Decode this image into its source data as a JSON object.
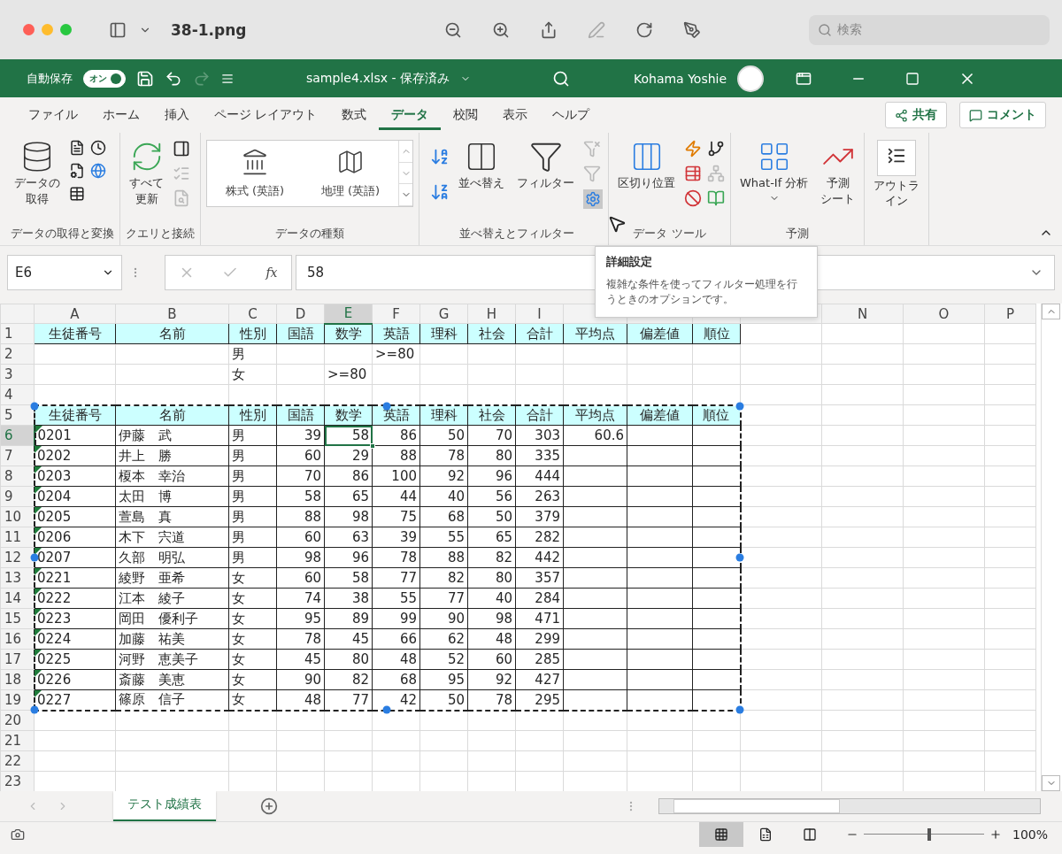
{
  "viewer": {
    "title": "38-1.png",
    "search_placeholder": "検索"
  },
  "excel_bar": {
    "autosave_label": "自動保存",
    "autosave": {
      "on": true,
      "label": "オン"
    },
    "redo_disabled": true,
    "file_title": "sample4.xlsx - 保存済み",
    "user": "Kohama Yoshie"
  },
  "ribbon_tabs": [
    {
      "label": "ファイル",
      "selected": false
    },
    {
      "label": "ホーム",
      "selected": false
    },
    {
      "label": "挿入",
      "selected": false
    },
    {
      "label": "ページ レイアウト",
      "selected": false
    },
    {
      "label": "数式",
      "selected": false
    },
    {
      "label": "データ",
      "selected": true
    },
    {
      "label": "校閲",
      "selected": false
    },
    {
      "label": "表示",
      "selected": false
    },
    {
      "label": "ヘルプ",
      "selected": false
    }
  ],
  "share_button": "共有",
  "comment_button": "コメント",
  "ribbon_groups": [
    {
      "kind": "get",
      "label": "データの取得と変換",
      "button": [
        "データの",
        "取得"
      ]
    },
    {
      "kind": "queries",
      "label": "クエリと接続",
      "button": [
        "すべて",
        "更新"
      ]
    },
    {
      "kind": "types",
      "label": "データの種類",
      "items": [
        "株式 (英語)",
        "地理 (英語)"
      ]
    },
    {
      "kind": "sort",
      "label": "並べ替えとフィルター",
      "sort": "並べ替え",
      "filter": "フィルター",
      "advanced_hovered": true
    },
    {
      "kind": "tools",
      "label": "データ ツール",
      "button": "区切り位置"
    },
    {
      "kind": "forecast",
      "label": "予測",
      "what_if": "What-If 分析",
      "sheet": [
        "予測",
        "シート"
      ]
    },
    {
      "kind": "outline",
      "button": [
        "アウトラ",
        "イン"
      ]
    }
  ],
  "formula_bar": {
    "name_box": "E6",
    "function_symbol": "fx",
    "value": "58"
  },
  "tooltip": {
    "title": "詳細設定",
    "text": "複雑な条件を使ってフィルター処理を行うときのオプションです。"
  },
  "columns": [
    {
      "label": "A",
      "selected": false
    },
    {
      "label": "B",
      "selected": false
    },
    {
      "label": "C",
      "selected": false
    },
    {
      "label": "D",
      "selected": false
    },
    {
      "label": "E",
      "selected": true
    },
    {
      "label": "F",
      "selected": false
    },
    {
      "label": "G",
      "selected": false
    },
    {
      "label": "H",
      "selected": false
    },
    {
      "label": "I",
      "selected": false
    },
    {
      "selected": false
    },
    {
      "selected": false
    },
    {
      "selected": false
    },
    {
      "selected": false
    },
    {
      "label": "N",
      "selected": false
    },
    {
      "label": "O",
      "selected": false
    },
    {
      "label": "P",
      "selected": false
    }
  ],
  "rows": [
    {
      "number": "1",
      "kind": "header",
      "selected": false,
      "in_marquee": false,
      "cells": [
        "生徒番号",
        "名前",
        "性別",
        "国語",
        "数学",
        "英語",
        "理科",
        "社会",
        "合計",
        "平均点",
        "偏差値",
        "順位"
      ]
    },
    {
      "number": "2",
      "kind": "criteria",
      "selected": false,
      "in_marquee": false,
      "cells": [
        null,
        null,
        "男",
        null,
        null,
        ">=80"
      ]
    },
    {
      "number": "3",
      "kind": "criteria",
      "selected": false,
      "in_marquee": false,
      "cells": [
        null,
        null,
        "女",
        null,
        ">=80"
      ]
    },
    {
      "number": "4",
      "kind": "blank",
      "selected": false,
      "in_marquee": false,
      "cells": []
    },
    {
      "number": "5",
      "kind": "header",
      "selected": false,
      "in_marquee": true,
      "cells": [
        "生徒番号",
        "名前",
        "性別",
        "国語",
        "数学",
        "英語",
        "理科",
        "社会",
        "合計",
        "平均点",
        "偏差値",
        "順位"
      ]
    },
    {
      "number": "6",
      "kind": "data",
      "selected": true,
      "in_marquee": true,
      "flagged": true,
      "cells": [
        "0201",
        "伊藤　武",
        "男",
        "39",
        "58",
        "86",
        "50",
        "70",
        "303",
        "60.6"
      ]
    },
    {
      "number": "7",
      "kind": "data",
      "selected": false,
      "in_marquee": true,
      "flagged": true,
      "cells": [
        "0202",
        "井上　勝",
        "男",
        "60",
        "29",
        "88",
        "78",
        "80",
        "335"
      ]
    },
    {
      "number": "8",
      "kind": "data",
      "selected": false,
      "in_marquee": true,
      "flagged": true,
      "cells": [
        "0203",
        "榎本　幸治",
        "男",
        "70",
        "86",
        "100",
        "92",
        "96",
        "444"
      ]
    },
    {
      "number": "9",
      "kind": "data",
      "selected": false,
      "in_marquee": true,
      "flagged": true,
      "cells": [
        "0204",
        "太田　博",
        "男",
        "58",
        "65",
        "44",
        "40",
        "56",
        "263"
      ]
    },
    {
      "number": "10",
      "kind": "data",
      "selected": false,
      "in_marquee": true,
      "flagged": true,
      "cells": [
        "0205",
        "萱島　真",
        "男",
        "88",
        "98",
        "75",
        "68",
        "50",
        "379"
      ]
    },
    {
      "number": "11",
      "kind": "data",
      "selected": false,
      "in_marquee": true,
      "flagged": true,
      "cells": [
        "0206",
        "木下　宍道",
        "男",
        "60",
        "63",
        "39",
        "55",
        "65",
        "282"
      ]
    },
    {
      "number": "12",
      "kind": "data",
      "selected": false,
      "in_marquee": true,
      "flagged": true,
      "cells": [
        "0207",
        "久部　明弘",
        "男",
        "98",
        "96",
        "78",
        "88",
        "82",
        "442"
      ]
    },
    {
      "number": "13",
      "kind": "data",
      "selected": false,
      "in_marquee": true,
      "flagged": true,
      "cells": [
        "0221",
        "綾野　亜希",
        "女",
        "60",
        "58",
        "77",
        "82",
        "80",
        "357"
      ]
    },
    {
      "number": "14",
      "kind": "data",
      "selected": false,
      "in_marquee": true,
      "flagged": true,
      "cells": [
        "0222",
        "江本　綾子",
        "女",
        "74",
        "38",
        "55",
        "77",
        "40",
        "284"
      ]
    },
    {
      "number": "15",
      "kind": "data",
      "selected": false,
      "in_marquee": true,
      "flagged": true,
      "cells": [
        "0223",
        "岡田　優利子",
        "女",
        "95",
        "89",
        "99",
        "90",
        "98",
        "471"
      ]
    },
    {
      "number": "16",
      "kind": "data",
      "selected": false,
      "in_marquee": true,
      "flagged": true,
      "cells": [
        "0224",
        "加藤　祐美",
        "女",
        "78",
        "45",
        "66",
        "62",
        "48",
        "299"
      ]
    },
    {
      "number": "17",
      "kind": "data",
      "selected": false,
      "in_marquee": true,
      "flagged": true,
      "cells": [
        "0225",
        "河野　恵美子",
        "女",
        "45",
        "80",
        "48",
        "52",
        "60",
        "285"
      ]
    },
    {
      "number": "18",
      "kind": "data",
      "selected": false,
      "in_marquee": true,
      "flagged": true,
      "cells": [
        "0226",
        "斎藤　美恵",
        "女",
        "90",
        "82",
        "68",
        "95",
        "92",
        "427"
      ]
    },
    {
      "number": "19",
      "kind": "data",
      "selected": false,
      "in_marquee": true,
      "flagged": true,
      "cells": [
        "0227",
        "篠原　信子",
        "女",
        "48",
        "77",
        "42",
        "50",
        "78",
        "295"
      ]
    },
    {
      "number": "20",
      "kind": "blank",
      "selected": false,
      "in_marquee": false,
      "cells": []
    },
    {
      "number": "21",
      "kind": "blank",
      "selected": false,
      "in_marquee": false,
      "cells": []
    },
    {
      "number": "22",
      "kind": "blank",
      "selected": false,
      "in_marquee": false,
      "cells": []
    },
    {
      "number": "23",
      "kind": "blank",
      "selected": false,
      "in_marquee": false,
      "cells": []
    }
  ],
  "sheet_tabs": [
    {
      "label": "テスト成績表",
      "selected": true
    }
  ],
  "status_bar": {
    "views": [
      {
        "kind": "normal",
        "selected": true
      },
      {
        "kind": "page_layout",
        "selected": false
      },
      {
        "kind": "page_break",
        "selected": false
      }
    ],
    "zoom": {
      "level": 0.53,
      "reading": "100%"
    }
  }
}
